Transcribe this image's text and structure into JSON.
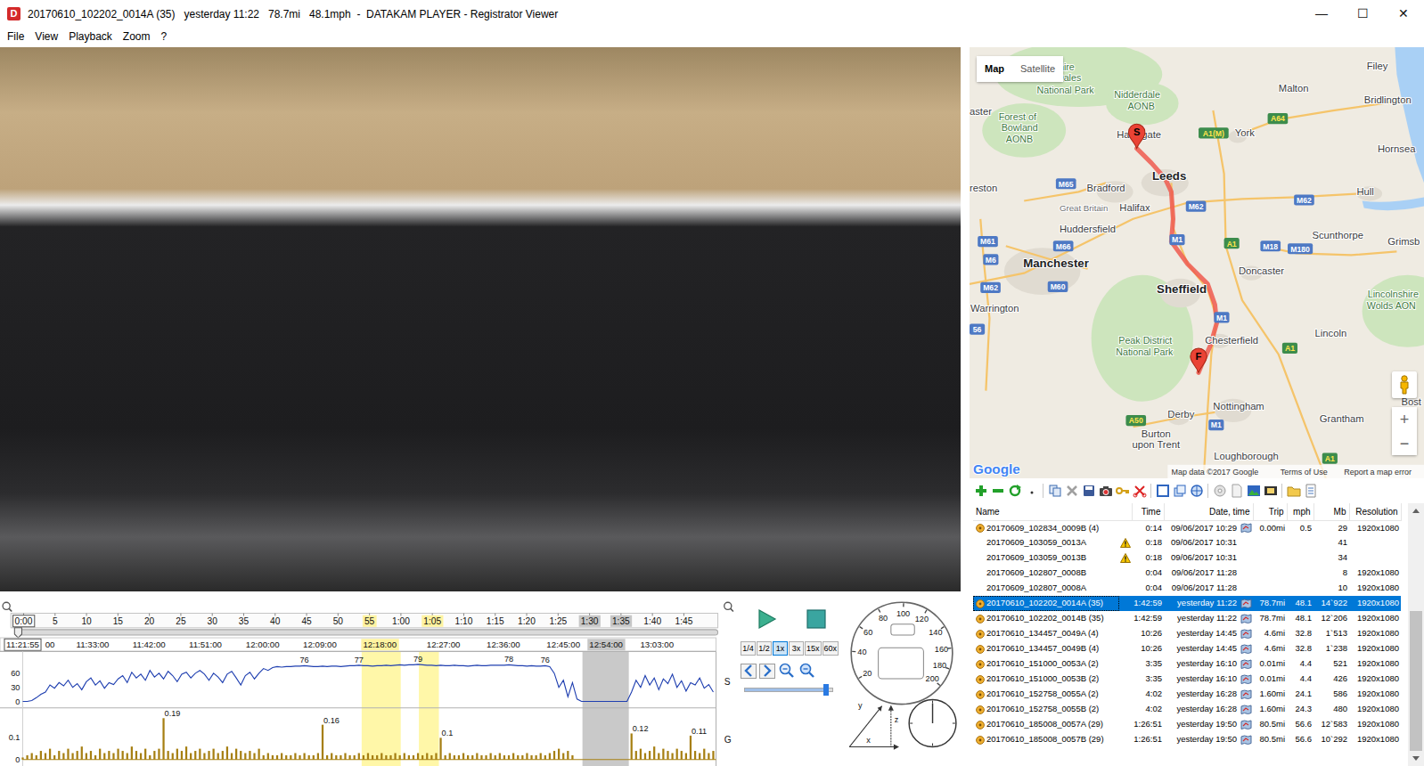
{
  "window": {
    "icon": "D",
    "title": "20170610_102202_0014A (35)   yesterday 11:22   78.7mi   48.1mph  -  DATAKAM PLAYER - Registrator Viewer",
    "controls": [
      "—",
      "☐",
      "✕"
    ]
  },
  "menu": [
    "File",
    "View",
    "Playback",
    "Zoom",
    "?"
  ],
  "map": {
    "tabs": [
      {
        "label": "Map",
        "selected": true
      },
      {
        "label": "Satellite",
        "selected": false
      }
    ],
    "zoom_in": "+",
    "zoom_out": "−",
    "route": {
      "start": "S",
      "finish": "F"
    },
    "logo": "Google",
    "footer": [
      "Map data ©2017 Google",
      "Terms of Use",
      "Report a map error"
    ],
    "labels": [
      {
        "text": "rkshire",
        "kind": "area"
      },
      {
        "text": "Dales",
        "kind": "area"
      },
      {
        "text": "National Park",
        "kind": "area"
      },
      {
        "text": "Nidderdale",
        "kind": "area"
      },
      {
        "text": "AONB",
        "kind": "area"
      },
      {
        "text": "aster",
        "kind": "city"
      },
      {
        "text": "Forest of",
        "kind": "area"
      },
      {
        "text": "Bowland",
        "kind": "area"
      },
      {
        "text": "AONB",
        "kind": "area"
      },
      {
        "text": "Harrogate",
        "kind": "city"
      },
      {
        "text": "York",
        "kind": "city"
      },
      {
        "text": "Malton",
        "kind": "city"
      },
      {
        "text": "Filey",
        "kind": "city"
      },
      {
        "text": "Bridlington",
        "kind": "city"
      },
      {
        "text": "Hornsea",
        "kind": "city"
      },
      {
        "text": "Leeds",
        "kind": "big"
      },
      {
        "text": "Bradford",
        "kind": "city"
      },
      {
        "text": "reston",
        "kind": "city"
      },
      {
        "text": "Great Britain",
        "kind": "faint"
      },
      {
        "text": "Halifax",
        "kind": "city"
      },
      {
        "text": "Huddersfield",
        "kind": "city"
      },
      {
        "text": "Hull",
        "kind": "city"
      },
      {
        "text": "Scunthorpe",
        "kind": "city"
      },
      {
        "text": "Grimsb",
        "kind": "city"
      },
      {
        "text": "Manchester",
        "kind": "big"
      },
      {
        "text": "Doncaster",
        "kind": "city"
      },
      {
        "text": "Warrington",
        "kind": "city"
      },
      {
        "text": "Sheffield",
        "kind": "big"
      },
      {
        "text": "Lincolnshire",
        "kind": "area"
      },
      {
        "text": "Wolds AON",
        "kind": "area"
      },
      {
        "text": "Peak District",
        "kind": "area"
      },
      {
        "text": "National Park",
        "kind": "area"
      },
      {
        "text": "Chesterfield",
        "kind": "city"
      },
      {
        "text": "Lincoln",
        "kind": "city"
      },
      {
        "text": "56",
        "kind": "motorway"
      },
      {
        "text": "Bost",
        "kind": "city"
      },
      {
        "text": "Nottingham",
        "kind": "city"
      },
      {
        "text": "Derby",
        "kind": "city"
      },
      {
        "text": "Grantham",
        "kind": "city"
      },
      {
        "text": "Burton",
        "kind": "city"
      },
      {
        "text": "upon Trent",
        "kind": "city"
      },
      {
        "text": "Loughborough",
        "kind": "city"
      },
      {
        "text": "A64",
        "kind": "aroad"
      },
      {
        "text": "A1(M)",
        "kind": "aroad"
      },
      {
        "text": "M65",
        "kind": "motorway"
      },
      {
        "text": "M62",
        "kind": "motorway"
      },
      {
        "text": "M62",
        "kind": "motorway"
      },
      {
        "text": "M1",
        "kind": "motorway"
      },
      {
        "text": "A1",
        "kind": "aroad"
      },
      {
        "text": "M18",
        "kind": "motorway"
      },
      {
        "text": "M180",
        "kind": "motorway"
      },
      {
        "text": "M61",
        "kind": "motorway"
      },
      {
        "text": "M66",
        "kind": "motorway"
      },
      {
        "text": "M6",
        "kind": "motorway"
      },
      {
        "text": "M60",
        "kind": "motorway"
      },
      {
        "text": "M62",
        "kind": "motorway"
      },
      {
        "text": "M1",
        "kind": "motorway"
      },
      {
        "text": "A1",
        "kind": "aroad"
      },
      {
        "text": "M1",
        "kind": "motorway"
      },
      {
        "text": "A50",
        "kind": "aroad"
      },
      {
        "text": "A1",
        "kind": "aroad"
      }
    ]
  },
  "table": {
    "columns": [
      "Name",
      "Time",
      "Date, time",
      "Trip",
      "mph",
      "Mb",
      "Resolution"
    ],
    "rows": [
      {
        "name": "20170609_102834_0009B (4)",
        "kind": "film",
        "warning": false,
        "time": "0:14",
        "date": "09/06/2017 10:29",
        "gps": true,
        "trip": "0.00mi",
        "mph": "0.5",
        "mb": "29",
        "resolution": "1920x1080",
        "selected": false
      },
      {
        "name": "20170609_103059_0013A",
        "kind": "plain",
        "warning": true,
        "time": "0:18",
        "date": "09/06/2017 10:31",
        "gps": false,
        "trip": "",
        "mph": "",
        "mb": "41",
        "resolution": "",
        "selected": false
      },
      {
        "name": "20170609_103059_0013B",
        "kind": "plain",
        "warning": true,
        "time": "0:18",
        "date": "09/06/2017 10:31",
        "gps": false,
        "trip": "",
        "mph": "",
        "mb": "34",
        "resolution": "",
        "selected": false
      },
      {
        "name": "20170609_102807_0008B",
        "kind": "plain",
        "warning": false,
        "time": "0:04",
        "date": "09/06/2017 11:28",
        "gps": false,
        "trip": "",
        "mph": "",
        "mb": "8",
        "resolution": "1920x1080",
        "selected": false
      },
      {
        "name": "20170609_102807_0008A",
        "kind": "plain",
        "warning": false,
        "time": "0:04",
        "date": "09/06/2017 11:28",
        "gps": false,
        "trip": "",
        "mph": "",
        "mb": "10",
        "resolution": "1920x1080",
        "selected": false
      },
      {
        "name": "20170610_102202_0014A (35)",
        "kind": "film",
        "warning": false,
        "time": "1:42:59",
        "date": "yesterday 11:22",
        "gps": true,
        "trip": "78.7mi",
        "mph": "48.1",
        "mb": "14`922",
        "resolution": "1920x1080",
        "selected": true
      },
      {
        "name": "20170610_102202_0014B (35)",
        "kind": "film",
        "warning": false,
        "time": "1:42:59",
        "date": "yesterday 11:22",
        "gps": true,
        "trip": "78.7mi",
        "mph": "48.1",
        "mb": "12`206",
        "resolution": "1920x1080",
        "selected": false
      },
      {
        "name": "20170610_134457_0049A (4)",
        "kind": "film",
        "warning": false,
        "time": "10:26",
        "date": "yesterday 14:45",
        "gps": true,
        "trip": "4.6mi",
        "mph": "32.8",
        "mb": "1`513",
        "resolution": "1920x1080",
        "selected": false
      },
      {
        "name": "20170610_134457_0049B (4)",
        "kind": "film",
        "warning": false,
        "time": "10:26",
        "date": "yesterday 14:45",
        "gps": true,
        "trip": "4.6mi",
        "mph": "32.8",
        "mb": "1`238",
        "resolution": "1920x1080",
        "selected": false
      },
      {
        "name": "20170610_151000_0053A (2)",
        "kind": "film",
        "warning": false,
        "time": "3:35",
        "date": "yesterday 16:10",
        "gps": true,
        "trip": "0.01mi",
        "mph": "4.4",
        "mb": "521",
        "resolution": "1920x1080",
        "selected": false
      },
      {
        "name": "20170610_151000_0053B (2)",
        "kind": "film",
        "warning": false,
        "time": "3:35",
        "date": "yesterday 16:10",
        "gps": true,
        "trip": "0.01mi",
        "mph": "4.4",
        "mb": "426",
        "resolution": "1920x1080",
        "selected": false
      },
      {
        "name": "20170610_152758_0055A (2)",
        "kind": "film",
        "warning": false,
        "time": "4:02",
        "date": "yesterday 16:28",
        "gps": true,
        "trip": "1.60mi",
        "mph": "24.1",
        "mb": "586",
        "resolution": "1920x1080",
        "selected": false
      },
      {
        "name": "20170610_152758_0055B (2)",
        "kind": "film",
        "warning": false,
        "time": "4:02",
        "date": "yesterday 16:28",
        "gps": true,
        "trip": "1.60mi",
        "mph": "24.3",
        "mb": "480",
        "resolution": "1920x1080",
        "selected": false
      },
      {
        "name": "20170610_185008_0057A (29)",
        "kind": "film",
        "warning": false,
        "time": "1:26:51",
        "date": "yesterday 19:50",
        "gps": true,
        "trip": "80.5mi",
        "mph": "56.6",
        "mb": "12`583",
        "resolution": "1920x1080",
        "selected": false
      },
      {
        "name": "20170610_185008_0057B (29)",
        "kind": "film",
        "warning": false,
        "time": "1:26:51",
        "date": "yesterday 19:50",
        "gps": true,
        "trip": "80.5mi",
        "mph": "56.6",
        "mb": "10`292",
        "resolution": "1920x1080",
        "selected": false
      }
    ],
    "scroll": {
      "level": 1
    }
  },
  "timeline": {
    "level": 0,
    "scale": [
      {
        "label": "0:00",
        "kind": "boxed"
      },
      {
        "label": "5",
        "kind": "plain"
      },
      {
        "label": "10",
        "kind": "plain"
      },
      {
        "label": "15",
        "kind": "plain"
      },
      {
        "label": "20",
        "kind": "plain"
      },
      {
        "label": "25",
        "kind": "plain"
      },
      {
        "label": "30",
        "kind": "plain"
      },
      {
        "label": "35",
        "kind": "plain"
      },
      {
        "label": "40",
        "kind": "plain"
      },
      {
        "label": "45",
        "kind": "plain"
      },
      {
        "label": "50",
        "kind": "plain"
      },
      {
        "label": "55",
        "kind": "yellow"
      },
      {
        "label": "1:00",
        "kind": "plain"
      },
      {
        "label": "1:05",
        "kind": "yellow"
      },
      {
        "label": "1:10",
        "kind": "plain"
      },
      {
        "label": "1:15",
        "kind": "plain"
      },
      {
        "label": "1:20",
        "kind": "plain"
      },
      {
        "label": "1:25",
        "kind": "plain"
      },
      {
        "label": "1:30",
        "kind": "grey"
      },
      {
        "label": "1:35",
        "kind": "grey"
      },
      {
        "label": "1:40",
        "kind": "plain"
      },
      {
        "label": "1:45",
        "kind": "plain"
      }
    ],
    "times": [
      {
        "label": "11:21:55",
        "kind": "boxed"
      },
      {
        "label": "00",
        "kind": "plain"
      },
      {
        "label": "11:33:00",
        "kind": "plain"
      },
      {
        "label": "11:42:00",
        "kind": "plain"
      },
      {
        "label": "11:51:00",
        "kind": "plain"
      },
      {
        "label": "12:00:00",
        "kind": "plain"
      },
      {
        "label": "12:09:00",
        "kind": "plain"
      },
      {
        "label": "12:18:00",
        "kind": "yellow"
      },
      {
        "label": "12:27:00",
        "kind": "plain"
      },
      {
        "label": "12:36:00",
        "kind": "plain"
      },
      {
        "label": "12:45:00",
        "kind": "plain"
      },
      {
        "label": "12:54:00",
        "kind": "grey"
      },
      {
        "label": "13:03:00",
        "kind": "plain"
      }
    ]
  },
  "charts": {
    "bands": [
      {
        "start": 74.6,
        "end": 83.2,
        "color": "#fff7a8"
      },
      {
        "start": 87.2,
        "end": 91.6,
        "color": "#fff7a8"
      },
      {
        "start": 123.2,
        "end": 133.4,
        "color": "#c9c9c9"
      }
    ],
    "speed": {
      "label": "S",
      "ticks": [
        "60",
        "30",
        "0"
      ],
      "values": [
        0,
        0,
        2,
        8,
        15,
        20,
        35,
        28,
        40,
        33,
        45,
        30,
        38,
        25,
        42,
        50,
        35,
        44,
        28,
        40,
        36,
        48,
        55,
        40,
        62,
        50,
        58,
        45,
        66,
        52,
        60,
        48,
        64,
        55,
        42,
        58,
        62,
        50,
        60,
        66,
        58,
        45,
        60,
        52,
        40,
        58,
        64,
        50,
        35,
        55,
        62,
        48,
        60,
        70,
        66,
        72,
        74,
        73,
        74,
        74,
        75,
        75,
        76,
        75,
        74,
        74,
        75,
        74,
        75,
        75,
        74,
        75,
        76,
        76,
        77,
        76,
        76,
        75,
        76,
        76,
        77,
        76,
        77,
        78,
        77,
        78,
        78,
        79,
        78,
        77,
        77,
        76,
        77,
        76,
        76,
        77,
        76,
        76,
        75,
        76,
        77,
        76,
        76,
        77,
        77,
        77,
        77,
        78,
        77,
        76,
        76,
        75,
        76,
        75,
        75,
        76,
        74,
        60,
        30,
        45,
        10,
        40,
        5,
        0,
        0,
        0,
        0,
        0,
        0,
        0,
        0,
        0,
        0,
        0,
        20,
        45,
        30,
        55,
        35,
        50,
        25,
        48,
        38,
        58,
        30,
        44,
        22,
        40,
        35,
        50,
        28,
        36,
        20
      ],
      "peaks": [
        {
          "label": "76",
          "index": 62
        },
        {
          "label": "77",
          "index": 74
        },
        {
          "label": "79",
          "index": 87
        },
        {
          "label": "78",
          "index": 107
        },
        {
          "label": "76",
          "index": 115
        }
      ]
    },
    "g": {
      "label": "G",
      "ticks": [
        "0.1",
        "0"
      ],
      "values": [
        0.01,
        0.02,
        0.03,
        0.02,
        0.04,
        0.03,
        0.05,
        0.02,
        0.04,
        0.03,
        0.05,
        0.03,
        0.04,
        0.06,
        0.03,
        0.04,
        0.02,
        0.05,
        0.03,
        0.04,
        0.03,
        0.05,
        0.04,
        0.03,
        0.06,
        0.04,
        0.03,
        0.05,
        0.02,
        0.04,
        0.05,
        0.19,
        0.04,
        0.03,
        0.05,
        0.04,
        0.06,
        0.03,
        0.04,
        0.05,
        0.03,
        0.04,
        0.05,
        0.03,
        0.04,
        0.06,
        0.03,
        0.05,
        0.04,
        0.03,
        0.04,
        0.03,
        0.05,
        0.02,
        0.03,
        0.02,
        0.02,
        0.03,
        0.02,
        0.02,
        0.03,
        0.02,
        0.03,
        0.02,
        0.02,
        0.03,
        0.16,
        0.02,
        0.03,
        0.02,
        0.02,
        0.03,
        0.02,
        0.02,
        0.03,
        0.02,
        0.03,
        0.02,
        0.02,
        0.03,
        0.02,
        0.02,
        0.03,
        0.02,
        0.03,
        0.02,
        0.02,
        0.03,
        0.02,
        0.03,
        0.02,
        0.03,
        0.1,
        0.02,
        0.03,
        0.02,
        0.02,
        0.03,
        0.02,
        0.02,
        0.03,
        0.02,
        0.02,
        0.03,
        0.02,
        0.03,
        0.02,
        0.02,
        0.03,
        0.02,
        0.02,
        0.03,
        0.02,
        0.02,
        0.03,
        0.02,
        0.03,
        0.04,
        0.05,
        0.03,
        0.04,
        0.02,
        0,
        0,
        0,
        0,
        0,
        0,
        0,
        0,
        0,
        0,
        0,
        0,
        0.12,
        0.04,
        0.05,
        0.03,
        0.04,
        0.06,
        0.03,
        0.05,
        0.04,
        0.03,
        0.05,
        0.04,
        0.03,
        0.11,
        0.04,
        0.03,
        0.05,
        0.03,
        0.04
      ],
      "peaks": [
        {
          "label": "0.19",
          "index": 31
        },
        {
          "label": "0.16",
          "index": 66
        },
        {
          "label": "0.1",
          "index": 92
        },
        {
          "label": "0.12",
          "index": 134
        },
        {
          "label": "0.11",
          "index": 147
        }
      ]
    }
  },
  "playback": {
    "speeds": [
      {
        "label": "1/4",
        "selected": false
      },
      {
        "label": "1/2",
        "selected": false
      },
      {
        "label": "1x",
        "selected": true
      },
      {
        "label": "3x",
        "selected": false
      },
      {
        "label": "15x",
        "selected": false
      },
      {
        "label": "60x",
        "selected": false
      }
    ],
    "volume": {
      "level": 0.96
    }
  },
  "gauge": {
    "labels": [
      "20",
      "40",
      "60",
      "80",
      "100",
      "120",
      "140",
      "160",
      "180",
      "200"
    ]
  },
  "accel": {
    "axes": [
      "y",
      "z",
      "x"
    ]
  }
}
